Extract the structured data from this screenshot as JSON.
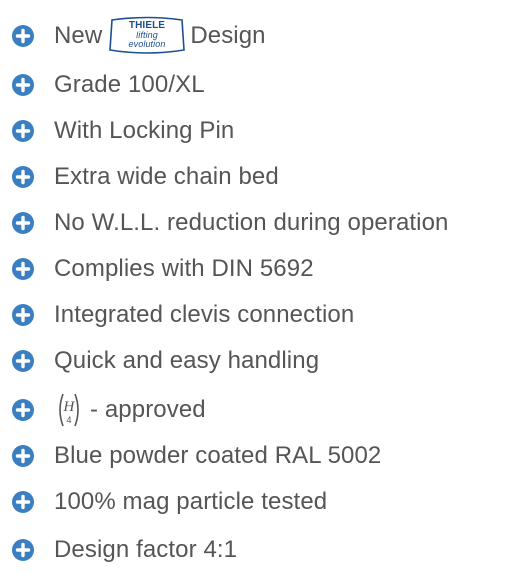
{
  "colors": {
    "bullet": "#3a7fc1",
    "text": "#555555"
  },
  "icons": {
    "bullet": "plus-circle-icon",
    "logo": "thiele-lifting-evolution-logo",
    "seal": "h4-approval-seal-icon"
  },
  "features": [
    {
      "before_logo": "New",
      "logo_text": "THIELE lifting evolution",
      "after_logo": "Design"
    },
    {
      "text": "Grade 100/XL"
    },
    {
      "text": "With Locking Pin"
    },
    {
      "text": "Extra wide chain bed"
    },
    {
      "text": "No W.L.L. reduction during operation"
    },
    {
      "text": "Complies with DIN 5692"
    },
    {
      "text": "Integrated clevis connection"
    },
    {
      "text": "Quick and easy handling"
    },
    {
      "seal_text": "H4",
      "text": "- approved"
    },
    {
      "text": "Blue powder coated RAL 5002"
    },
    {
      "text": "100% mag particle tested"
    },
    {
      "text": "Design factor 4:1"
    }
  ]
}
